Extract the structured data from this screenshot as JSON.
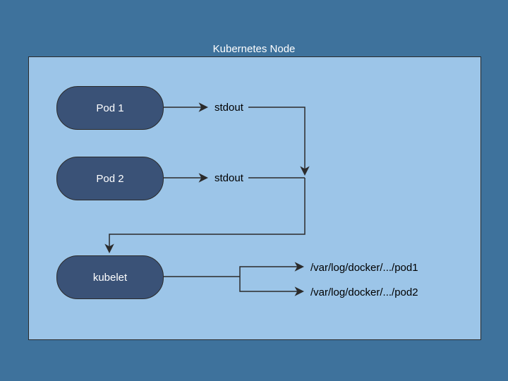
{
  "title": "Kubernetes Node",
  "pods": {
    "pod1": {
      "label": "Pod 1",
      "out": "stdout"
    },
    "pod2": {
      "label": "Pod 2",
      "out": "stdout"
    }
  },
  "kubelet": {
    "label": "kubelet",
    "logs": {
      "pod1": "/var/log/docker/.../pod1",
      "pod2": "/var/log/docker/.../pod2"
    }
  },
  "colors": {
    "bg": "#3e729c",
    "nodeBg": "#9cc5e8",
    "pill": "#3a5277",
    "stroke": "#2b2b2b"
  },
  "chart_data": {
    "type": "diagram",
    "title": "Kubernetes Node",
    "nodes": [
      {
        "id": "pod1",
        "label": "Pod 1",
        "shape": "rounded-rect"
      },
      {
        "id": "pod2",
        "label": "Pod 2",
        "shape": "rounded-rect"
      },
      {
        "id": "kubelet",
        "label": "kubelet",
        "shape": "rounded-rect"
      }
    ],
    "edges": [
      {
        "from": "pod1",
        "to": "kubelet",
        "label": "stdout"
      },
      {
        "from": "pod2",
        "to": "kubelet",
        "label": "stdout"
      },
      {
        "from": "kubelet",
        "to": "log1",
        "label": "/var/log/docker/.../pod1"
      },
      {
        "from": "kubelet",
        "to": "log2",
        "label": "/var/log/docker/.../pod2"
      }
    ],
    "container": "Kubernetes Node"
  }
}
